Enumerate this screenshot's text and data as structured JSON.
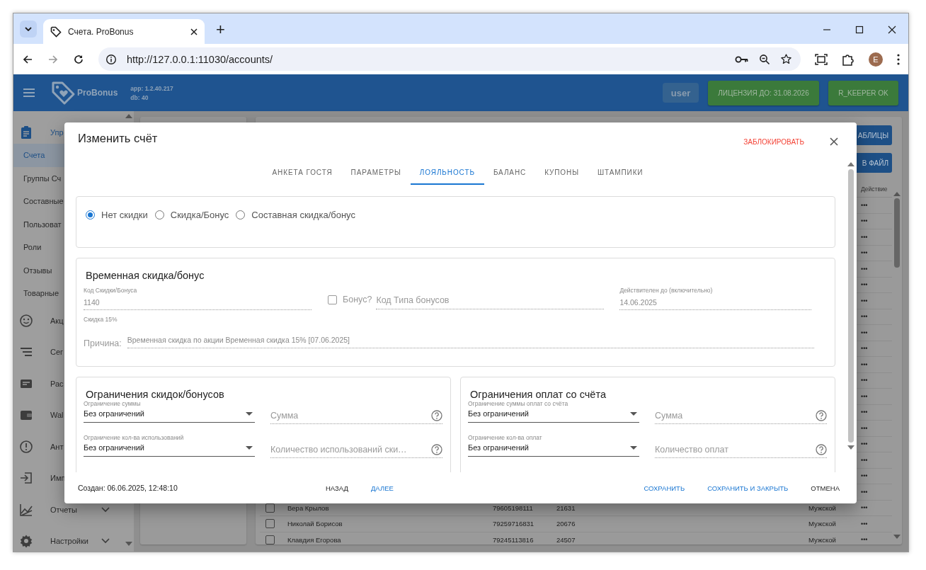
{
  "browser": {
    "tab_title": "Счета. ProBonus",
    "new_tab": "+",
    "url": "http://127.0.0.1:11030/accounts/",
    "profile_initial": "E"
  },
  "header": {
    "brand": "ProBonus",
    "app_version": "app: 1.2.40.217",
    "db_version": "db: 40",
    "user": "user",
    "license": "ЛИЦЕНЗИЯ ДО: 31.08.2026",
    "rkeeper": "R_KEEPER OK"
  },
  "sidebar": {
    "items": [
      {
        "label": "Упр",
        "kind": "section",
        "selected": false
      },
      {
        "label": "Счета",
        "kind": "link",
        "selected": true
      },
      {
        "label": "Группы Сч",
        "kind": "link",
        "selected": false
      },
      {
        "label": "Составные",
        "kind": "link",
        "selected": false
      },
      {
        "label": "Пользоват",
        "kind": "link",
        "selected": false
      },
      {
        "label": "Роли",
        "kind": "link",
        "selected": false
      },
      {
        "label": "Отзывы",
        "kind": "link",
        "selected": false
      },
      {
        "label": "Товарные",
        "kind": "link",
        "selected": false
      },
      {
        "label": "Акц",
        "kind": "section",
        "selected": false
      },
      {
        "label": "Сег",
        "kind": "section",
        "selected": false
      },
      {
        "label": "Рас",
        "kind": "section",
        "selected": false
      },
      {
        "label": "Wal",
        "kind": "section",
        "selected": false
      },
      {
        "label": "Ант",
        "kind": "section",
        "selected": false
      },
      {
        "label": "Имп",
        "kind": "section",
        "selected": false
      },
      {
        "label": "Отчеты",
        "kind": "group",
        "selected": false,
        "expanded": false
      },
      {
        "label": "Настройки",
        "kind": "group",
        "selected": false,
        "expanded": false
      }
    ]
  },
  "page": {
    "buttons": [
      "АБЛИЦЫ",
      "В ФАЙЛ"
    ],
    "action_column": "Действие",
    "rows": [
      {
        "action": "•••"
      },
      {
        "action": "•••"
      },
      {
        "action": "•••"
      },
      {
        "action": "•••"
      },
      {
        "action": "•••"
      },
      {
        "action": "•••"
      },
      {
        "action": "•••"
      },
      {
        "action": "•••"
      },
      {
        "action": "•••"
      },
      {
        "action": "•••"
      },
      {
        "action": "•••"
      },
      {
        "action": "•••"
      },
      {
        "action": "•••"
      },
      {
        "action": "•••"
      },
      {
        "action": "•••"
      },
      {
        "action": "•••"
      },
      {
        "action": "•••"
      },
      {
        "action": "•••"
      },
      {
        "action": "•••"
      },
      {
        "checked": false,
        "name": "Вера Крылов",
        "phone": "79605198111",
        "code": "21631",
        "gender": "Мужской",
        "action": "•••"
      },
      {
        "checked": false,
        "name": "Николай Борисов",
        "phone": "79259716831",
        "code": "20676",
        "gender": "Мужской",
        "action": "•••"
      },
      {
        "checked": false,
        "name": "Клавдия Егорова",
        "phone": "79245113816",
        "code": "24507",
        "gender": "Мужской",
        "action": "•••"
      }
    ]
  },
  "dialog": {
    "title": "Изменить счёт",
    "block_action": "ЗАБЛОКИРОВАТЬ",
    "tabs": [
      {
        "label": "АНКЕТА ГОСТЯ",
        "selected": false
      },
      {
        "label": "ПАРАМЕТРЫ",
        "selected": false
      },
      {
        "label": "ЛОЯЛЬНОСТЬ",
        "selected": true
      },
      {
        "label": "БАЛАНС",
        "selected": false
      },
      {
        "label": "КУПОНЫ",
        "selected": false
      },
      {
        "label": "ШТАМПИКИ",
        "selected": false
      }
    ],
    "discount_types": [
      {
        "label": "Нет скидки",
        "selected": true
      },
      {
        "label": "Скидка/Бонус",
        "selected": false
      },
      {
        "label": "Составная скидка/бонус",
        "selected": false
      }
    ],
    "temp_discount": {
      "title": "Временная скидка/бонус",
      "code_label": "Код Скидки/Бонуса",
      "code_value": "1140",
      "code_hint": "Скидка 15%",
      "bonus_label": "Бонус?",
      "bonus_checked": false,
      "bonus_type_placeholder": "Код Типа бонусов",
      "valid_label": "Действителен до (включительно)",
      "valid_value": "14.06.2025",
      "reason_label": "Причина:",
      "reason_value": "Временная скидка по акции Временная скидка 15% [07.06.2025]"
    },
    "limit_panels": [
      {
        "title": "Ограничения скидок/бонусов",
        "rows": [
          {
            "select_label": "Ограничение суммы",
            "select_value": "Без ограничений",
            "placeholder": "Сумма"
          },
          {
            "select_label": "Ограничение кол-ва использований",
            "select_value": "Без ограничений",
            "placeholder": "Количество использований ски…"
          }
        ]
      },
      {
        "title": "Ограничения оплат со счёта",
        "rows": [
          {
            "select_label": "Ограничение суммы оплат со счёта",
            "select_value": "Без ограничений",
            "placeholder": "Сумма"
          },
          {
            "select_label": "Ограничение кол-ва оплат",
            "select_value": "Без ограничений",
            "placeholder": "Количество оплат"
          }
        ]
      }
    ],
    "created": "Создан: 06.06.2025, 12:48:10",
    "nav_buttons": [
      {
        "label": "НАЗАД",
        "kind": "plain"
      },
      {
        "label": "ДАЛЕЕ",
        "kind": "primary"
      }
    ],
    "actions": [
      {
        "label": "СОХРАНИТЬ",
        "kind": "primary"
      },
      {
        "label": "СОХРАНИТЬ И ЗАКРЫТЬ",
        "kind": "primary"
      },
      {
        "label": "ОТМЕНА",
        "kind": "plain"
      }
    ]
  }
}
